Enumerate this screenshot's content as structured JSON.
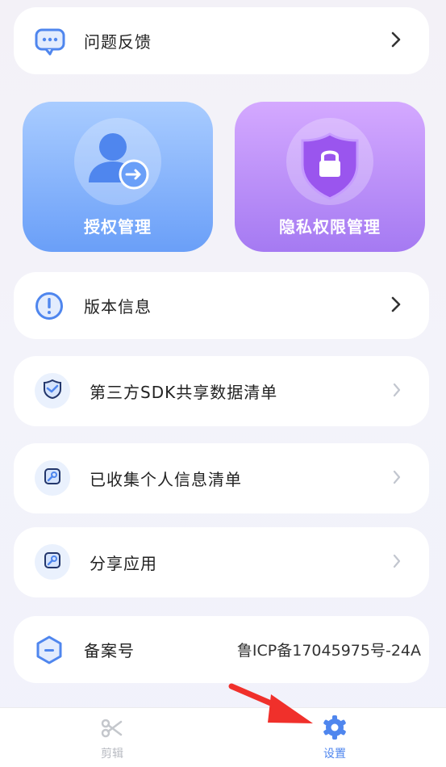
{
  "menu": {
    "feedback": "问题反馈",
    "version": "版本信息",
    "sdk_list": "第三方SDK共享数据清单",
    "personal_info": "已收集个人信息清单",
    "share_app": "分享应用",
    "icp_label": "备案号",
    "icp_value": "鲁ICP备17045975号-24A"
  },
  "cards": {
    "auth": "授权管理",
    "privacy": "隐私权限管理"
  },
  "tabbar": {
    "edit": "剪辑",
    "settings": "设置",
    "active": "settings"
  },
  "colors": {
    "accent": "#4f86ee",
    "auth_card": "#6a9ff8",
    "privacy_card": "#a57af2",
    "arrow": "#f0302b"
  },
  "icons": [
    "chat-icon",
    "person-arrow-icon",
    "shield-lock-icon",
    "info-icon",
    "shield-check-icon",
    "tag-icon",
    "hexagon-icon",
    "scissors-icon",
    "gear-icon"
  ]
}
